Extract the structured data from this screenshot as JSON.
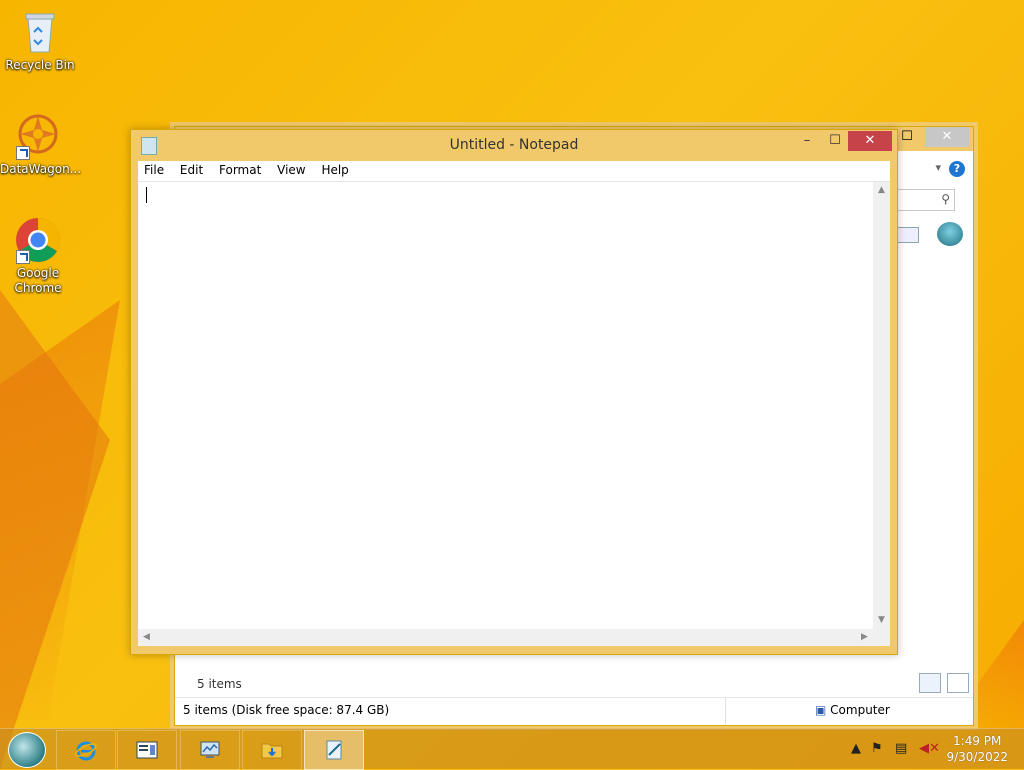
{
  "desktop": {
    "icons": [
      {
        "label": "Recycle Bin"
      },
      {
        "label": "DataWagon..."
      },
      {
        "label": "Google Chrome"
      }
    ]
  },
  "explorer": {
    "items_count": "5 items",
    "status_left": "5 items (Disk free space: 87.4 GB)",
    "status_right": "Computer",
    "help_label": "?"
  },
  "notepad": {
    "title": "Untitled - Notepad",
    "menu": [
      "File",
      "Edit",
      "Format",
      "View",
      "Help"
    ],
    "content": "",
    "close_label": "✕",
    "max_label": "☐",
    "min_label": "–"
  },
  "taskbar": {
    "buttons": [
      {
        "name": "internet-explorer",
        "icon": "ie-icon"
      },
      {
        "name": "app-window",
        "icon": "window-icon"
      },
      {
        "name": "app-monitor",
        "icon": "monitor-icon"
      },
      {
        "name": "file-explorer",
        "icon": "folder-icon"
      },
      {
        "name": "notepad",
        "icon": "notepad-icon"
      }
    ]
  },
  "tray": {
    "time": "1:49 PM",
    "date": "9/30/2022"
  },
  "colors": {
    "desktop": "#f7b500",
    "window_frame": "#f1c96a",
    "close_red": "#c7434a"
  }
}
